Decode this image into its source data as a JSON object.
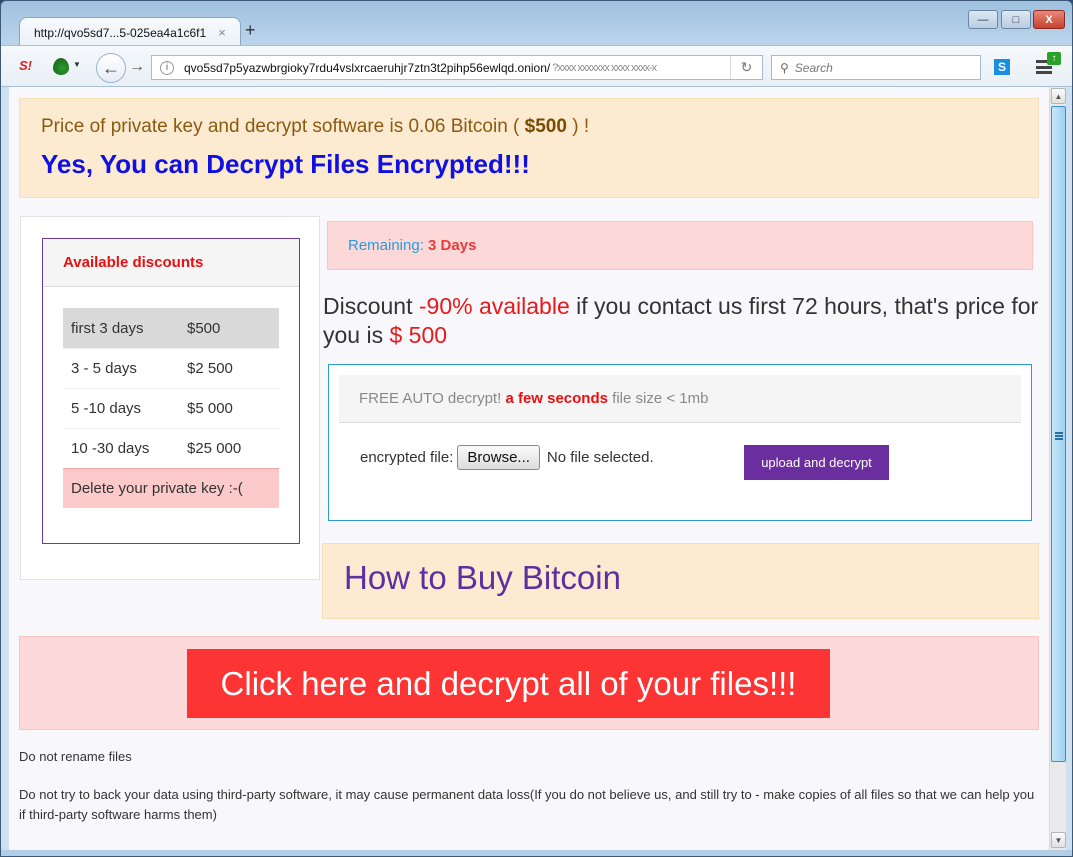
{
  "browser": {
    "tab_title": "http://qvo5sd7...5-025ea4a1c6f1",
    "tab_close": "×",
    "new_tab": "+",
    "window_controls": {
      "minimize": "—",
      "maximize": "□",
      "close": "X"
    },
    "url_main": "qvo5sd7p5yazwbrgioky7rdu4vslxrcaeruhjr7ztn3t2pihp56ewlqd.onion/",
    "url_obscured": "?xxxx xxxxxxx xxxx xxxx-x",
    "search_placeholder": "Search",
    "icons": {
      "sj": "S!",
      "info": "i",
      "back": "←",
      "forward": "→",
      "reload": "↻",
      "search": "🔍",
      "s_button": "S",
      "update": "↑"
    }
  },
  "page": {
    "price_prefix": "Price of private key and decrypt software is 0.06 Bitcoin ( ",
    "price_amount": "$500",
    "price_suffix": " ) !",
    "headline": "Yes, You can Decrypt Files Encrypted!!!",
    "discounts": {
      "title": "Available discounts",
      "rows": [
        {
          "period": "first 3 days",
          "price": "$500"
        },
        {
          "period": "3 - 5 days",
          "price": "$2 500"
        },
        {
          "period": "5 -10 days",
          "price": "$5 000"
        },
        {
          "period": "10 -30 days",
          "price": "$25 000"
        }
      ],
      "final": "Delete your private key :-("
    },
    "remaining_label": "Remaining: ",
    "remaining_value": "3 Days",
    "discount_text": {
      "part1": "Discount ",
      "highlight": "-90% available",
      "part2": " if you contact us first 72 hours, that's price for you is ",
      "price": "$ 500"
    },
    "free_decrypt": {
      "prefix": "FREE AUTO decrypt! ",
      "highlight": "a few seconds",
      "suffix": " file size < 1mb",
      "file_label": "encrypted file:",
      "browse_label": "Browse...",
      "no_file": "No file selected.",
      "upload_label": "upload and decrypt"
    },
    "how_to_buy": "How to Buy Bitcoin",
    "cta": "Click here and decrypt all of your files!!!",
    "notes": [
      "Do not rename files",
      "Do not try to back your data using third-party software, it may cause permanent data loss(If you do not believe us, and still try to - make copies of all files so that we can help you if third-party software harms them)"
    ]
  },
  "colors": {
    "banner_bg": "#fcebd0",
    "headline": "#1010e0",
    "danger_bg": "#fdd8d8",
    "cta_button": "#fd3434",
    "upload_button": "#6a2e9e",
    "how_to_text": "#5e2fa0",
    "decrypt_border": "#2a9ad0"
  }
}
